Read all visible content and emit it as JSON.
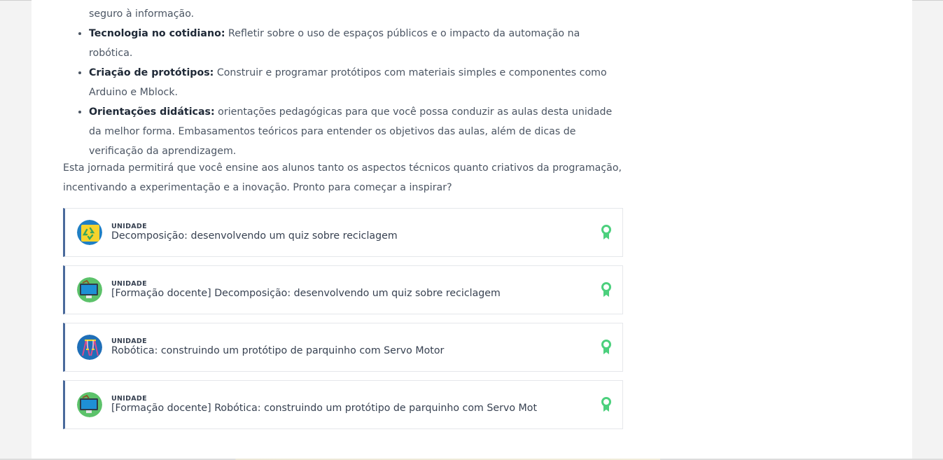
{
  "bullets": [
    {
      "bold": "",
      "text": "seguro à informação."
    },
    {
      "bold": "Tecnologia no cotidiano:",
      "text": " Refletir sobre o uso de espaços públicos e o impacto da automação na robótica."
    },
    {
      "bold": "Criação de protótipos:",
      "text": " Construir e programar protótipos com materiais simples e componentes como Arduino e Mblock."
    },
    {
      "bold": "Orientações didáticas:",
      "text": " orientações pedagógicas para que você possa conduzir as aulas desta unidade da melhor forma. Embasamentos teóricos para entender os objetivos das aulas, além de dicas de verificação da aprendizagem."
    }
  ],
  "intro": "Esta jornada permitirá que você ensine aos alunos tanto os aspectos técnicos quanto criativos da programação, incentivando a experimentação e a inovação. Pronto para começar a inspirar?",
  "units": [
    {
      "kicker": "UNIDADE",
      "title": "Decomposição: desenvolvendo um quiz sobre reciclagem",
      "icon": "recycle-icon"
    },
    {
      "kicker": "UNIDADE",
      "title": "[Formação docente] Decomposição: desenvolvendo um quiz sobre reciclagem",
      "icon": "monitor-icon"
    },
    {
      "kicker": "UNIDADE",
      "title": "Robótica: construindo um protótipo de parquinho com Servo Motor",
      "icon": "robotics-icon"
    },
    {
      "kicker": "UNIDADE",
      "title": "[Formação docente] Robótica: construindo um protótipo de parquinho com Servo Mot",
      "icon": "monitor-icon"
    }
  ],
  "colors": {
    "accent_border": "#4a6a9c",
    "badge_green": "#4cd07d"
  }
}
